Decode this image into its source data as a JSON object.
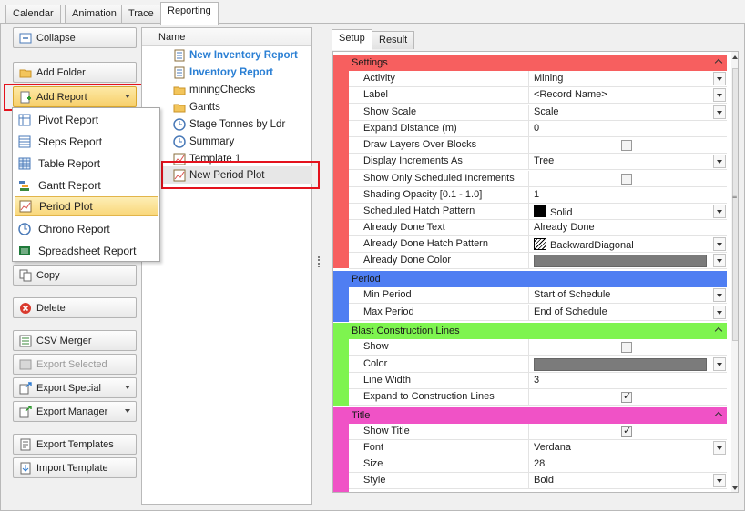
{
  "top_tabs": [
    "Calendar",
    "Animation",
    "Trace",
    "Reporting"
  ],
  "left_buttons": {
    "collapse": "Collapse",
    "add_folder": "Add Folder",
    "add_report": "Add Report",
    "copy": "Copy",
    "delete": "Delete",
    "csv_merger": "CSV Merger",
    "export_selected": "Export Selected",
    "export_special": "Export Special",
    "export_manager": "Export Manager",
    "export_templates": "Export Templates",
    "import_template": "Import Template"
  },
  "add_report_menu": [
    "Pivot Report",
    "Steps Report",
    "Table Report",
    "Gantt Report",
    "Period Plot",
    "Chrono Report",
    "Spreadsheet Report"
  ],
  "tree": {
    "header": "Name",
    "items": [
      "New Inventory Report",
      "Inventory Report",
      "miningChecks",
      "Gantts",
      "Stage Tonnes by Ldr",
      "Summary",
      "Template 1",
      "New Period Plot"
    ]
  },
  "right_tabs": [
    "Setup",
    "Result"
  ],
  "grid": {
    "settings": {
      "title": "Settings",
      "color": "#f75f5f",
      "rows": [
        {
          "label": "Activity",
          "value": "Mining"
        },
        {
          "label": "Label",
          "value": "<Record Name>"
        },
        {
          "label": "Show Scale",
          "value": "Scale"
        },
        {
          "label": "Expand Distance (m)",
          "value": "0"
        },
        {
          "label": "Draw Layers Over Blocks",
          "value": ""
        },
        {
          "label": "Display Increments As",
          "value": "Tree"
        },
        {
          "label": "Show Only Scheduled Increments",
          "value": ""
        },
        {
          "label": "Shading Opacity [0.1 - 1.0]",
          "value": "1"
        },
        {
          "label": "Scheduled Hatch Pattern",
          "value": "Solid"
        },
        {
          "label": "Already Done Text",
          "value": "Already Done"
        },
        {
          "label": "Already Done Hatch Pattern",
          "value": "BackwardDiagonal"
        },
        {
          "label": "Already Done Color",
          "value": ""
        }
      ]
    },
    "period": {
      "title": "Period",
      "color": "#4f7ef2",
      "rows": [
        {
          "label": "Min Period",
          "value": "Start of Schedule"
        },
        {
          "label": "Max Period",
          "value": "End of Schedule"
        }
      ]
    },
    "blast": {
      "title": "Blast Construction Lines",
      "color": "#7ef44f",
      "rows": [
        {
          "label": "Show",
          "value": ""
        },
        {
          "label": "Color",
          "value": ""
        },
        {
          "label": "Line Width",
          "value": "3"
        },
        {
          "label": "Expand to Construction Lines",
          "value": ""
        }
      ]
    },
    "title_cat": {
      "title": "Title",
      "color": "#f052c6",
      "rows": [
        {
          "label": "Show Title",
          "value": ""
        },
        {
          "label": "Font",
          "value": "Verdana"
        },
        {
          "label": "Size",
          "value": "28"
        },
        {
          "label": "Style",
          "value": "Bold"
        }
      ]
    }
  },
  "colors": {
    "highlight_box": "#e4121d",
    "tree_link": "#2a7fd4"
  }
}
